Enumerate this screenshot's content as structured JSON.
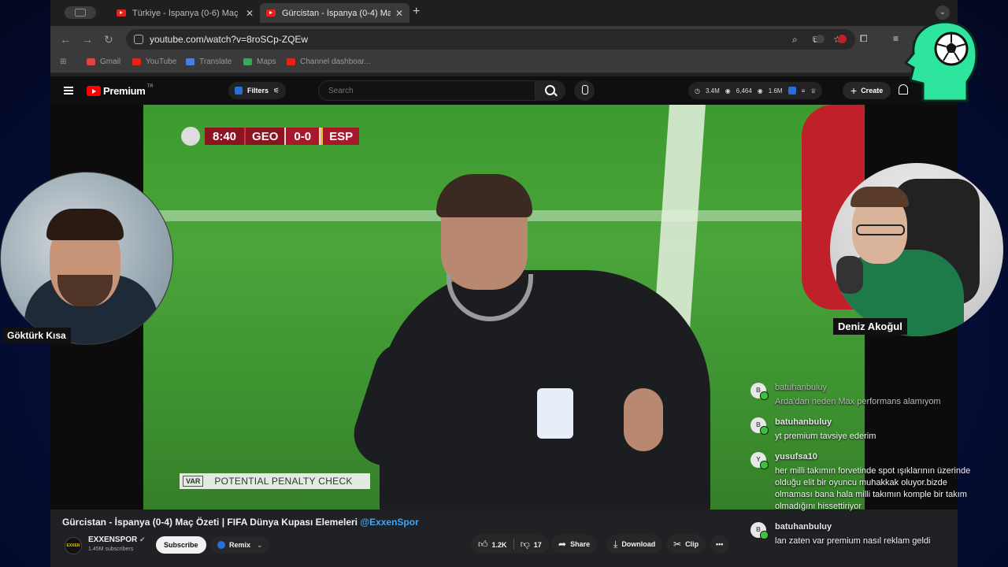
{
  "browser": {
    "tabs": [
      {
        "title": "Türkiye - İspanya (0-6) Maç Ö",
        "active": false
      },
      {
        "title": "Gürcistan - İspanya (0-4) Ma",
        "active": true
      }
    ],
    "new_tab_label": "+",
    "tab_menu_label": "⌄",
    "url": "youtube.com/watch?v=8roSCp-ZQEw",
    "bookmarks": [
      "Gmail",
      "YouTube",
      "Translate",
      "Maps",
      "Channel dashboar..."
    ]
  },
  "youtube": {
    "logo_text": "Premium",
    "logo_sup": "TR",
    "filters_label": "Filters",
    "search_placeholder": "Search",
    "stats": [
      "3.4M",
      "6,464",
      "1.6M"
    ],
    "create_label": "Create"
  },
  "video": {
    "scorebug": {
      "time": "8:40",
      "home": "GEO",
      "score": "0-0",
      "away": "ESP"
    },
    "var_tag": "VAR",
    "var_text": "POTENTIAL PENALTY CHECK",
    "title": "Gürcistan - İspanya (0-4) Maç Özeti | FIFA Dünya Kupası Elemeleri",
    "title_handle": "@ExxenSpor",
    "channel_logo_text": "EXXEN",
    "channel_name": "EXXENSPOR",
    "subscribers": "1.45M subscribers",
    "subscribe_label": "Subscribe",
    "remix_label": "Remix",
    "likes": "1.2K",
    "dislikes": "17",
    "share_label": "Share",
    "download_label": "Download",
    "clip_label": "Clip",
    "more_label": "•••"
  },
  "streamers": {
    "left_name": "Göktürk Kısa",
    "right_name": "Deniz Akoğul"
  },
  "chat": [
    {
      "initial": "B",
      "user": "batuhanbuluy",
      "text": "Arda'dan neden Max performans alamıyom"
    },
    {
      "initial": "B",
      "user": "batuhanbuluy",
      "text": "yt premium tavsiye ederim"
    },
    {
      "initial": "Y",
      "user": "yusufsa10",
      "text": "her milli takımın forvetinde spot ışıklarının üzerinde olduğu elit bir oyuncu muhakkak oluyor.bizde olmaması bana hala milli takımın komple bir takım olmadığını hissettiriyor"
    },
    {
      "initial": "B",
      "user": "batuhanbuluy",
      "text": "lan zaten var premium nasıl reklam geldi"
    }
  ],
  "colors": {
    "accent_red": "#ff0000",
    "score_red": "#8b1420",
    "mascot_green": "#2ee59d",
    "handle_blue": "#3ea6ff"
  }
}
